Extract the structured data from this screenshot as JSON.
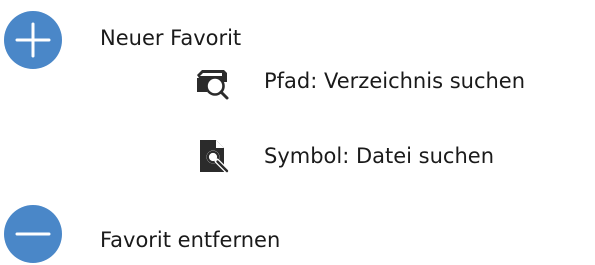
{
  "actions": {
    "add_favorite": {
      "label": "Neuer Favorit",
      "icon": "plus-icon"
    },
    "search_directory": {
      "label": "Pfad: Verzeichnis suchen",
      "icon": "folder-search-icon"
    },
    "search_file": {
      "label": "Symbol: Datei suchen",
      "icon": "file-search-icon"
    },
    "remove_favorite": {
      "label": "Favorit entfernen",
      "icon": "minus-icon"
    }
  },
  "colors": {
    "accent": "#4a87c8",
    "icon_dark": "#2b2b2b",
    "text": "#1a1a1a"
  }
}
